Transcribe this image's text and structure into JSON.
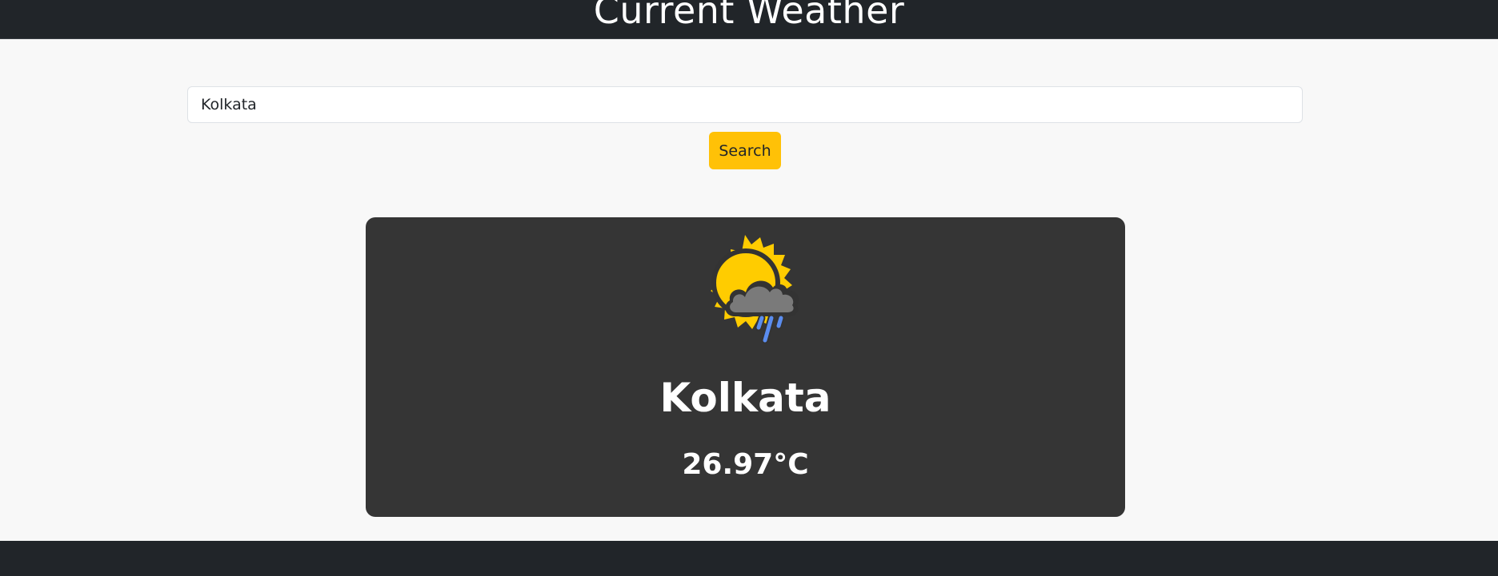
{
  "header": {
    "title": "Current Weather"
  },
  "search": {
    "value": "Kolkata",
    "button_label": "Search"
  },
  "weather": {
    "icon": "partly-sunny-rain-icon",
    "city": "Kolkata",
    "temperature": "26.97°C"
  },
  "colors": {
    "header_bg": "#212529",
    "page_bg": "#f8f8f8",
    "button_bg": "#ffc107",
    "card_bg": "#353535",
    "sun": "#ffcc00",
    "cloud": "#7a7a7a",
    "rain": "#5b8def"
  }
}
